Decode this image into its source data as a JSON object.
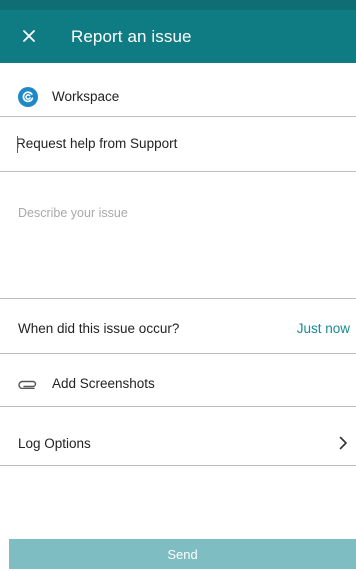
{
  "header": {
    "title": "Report an issue",
    "close_icon": "close-icon"
  },
  "app": {
    "icon": "workspace-logo-icon",
    "name": "Workspace"
  },
  "form": {
    "subject_value": "Request help from Support",
    "description_placeholder": "Describe your issue",
    "description_value": ""
  },
  "occurrence": {
    "label": "When did this issue occur?",
    "value": "Just now"
  },
  "screenshots": {
    "icon": "paperclip-icon",
    "label": "Add Screenshots"
  },
  "log_options": {
    "label": "Log Options",
    "icon": "chevron-right-icon"
  },
  "actions": {
    "send_label": "Send"
  },
  "colors": {
    "header_bg": "#0f7b83",
    "status_bar": "#0f6d74",
    "accent": "#1a8a93",
    "send_disabled_bg": "#7ebdc2"
  }
}
